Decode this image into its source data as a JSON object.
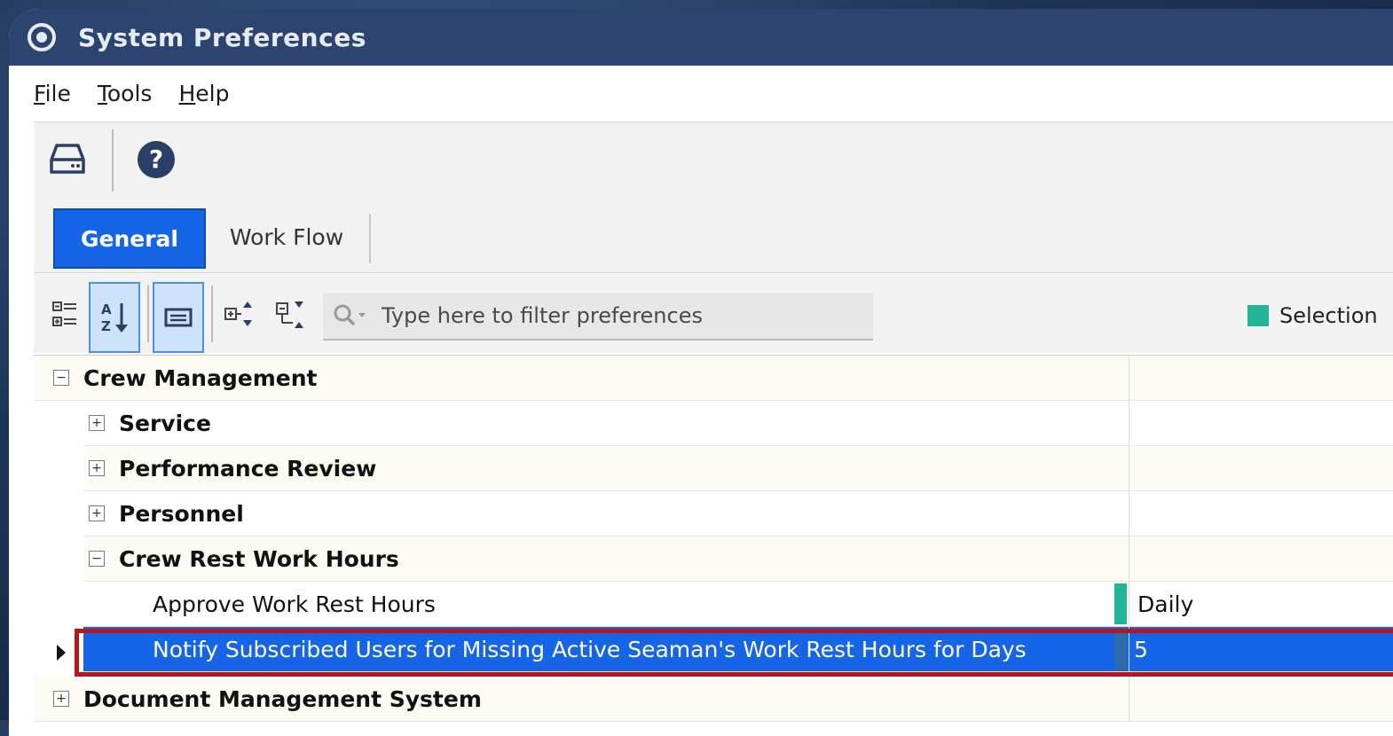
{
  "window": {
    "title": "System Preferences"
  },
  "menu": [
    {
      "mnemonic": "F",
      "rest": "ile"
    },
    {
      "mnemonic": "T",
      "rest": "ools"
    },
    {
      "mnemonic": "H",
      "rest": "elp"
    }
  ],
  "toolbar": {
    "save_icon": "drive-save-icon",
    "help_icon": "help-circle-icon"
  },
  "tabs": [
    {
      "label": "General",
      "active": true
    },
    {
      "label": "Work Flow",
      "active": false
    }
  ],
  "filter": {
    "placeholder": "Type here to filter preferences"
  },
  "legend": {
    "label": "Selection",
    "color": "#22b59a"
  },
  "grid": {
    "rows": [
      {
        "label": "Crew Management",
        "type": "category",
        "expander": "−",
        "value": ""
      },
      {
        "label": "Service",
        "type": "group",
        "expander": "+",
        "value": ""
      },
      {
        "label": "Performance Review",
        "type": "group",
        "expander": "+",
        "value": ""
      },
      {
        "label": "Personnel",
        "type": "group",
        "expander": "+",
        "value": ""
      },
      {
        "label": "Crew Rest Work Hours",
        "type": "group",
        "expander": "−",
        "value": ""
      },
      {
        "label": "Approve Work Rest Hours",
        "type": "item",
        "value": "Daily"
      },
      {
        "label": "Notify Subscribed Users for Missing Active Seaman's Work Rest Hours for Days",
        "type": "item",
        "value": "5",
        "selected": true
      },
      {
        "label": "Document Management System",
        "type": "category",
        "expander": "+",
        "value": ""
      }
    ]
  },
  "colors": {
    "accent": "#1565e6",
    "titlebar": "#2e4470",
    "highlight_outline": "#b3161c"
  }
}
